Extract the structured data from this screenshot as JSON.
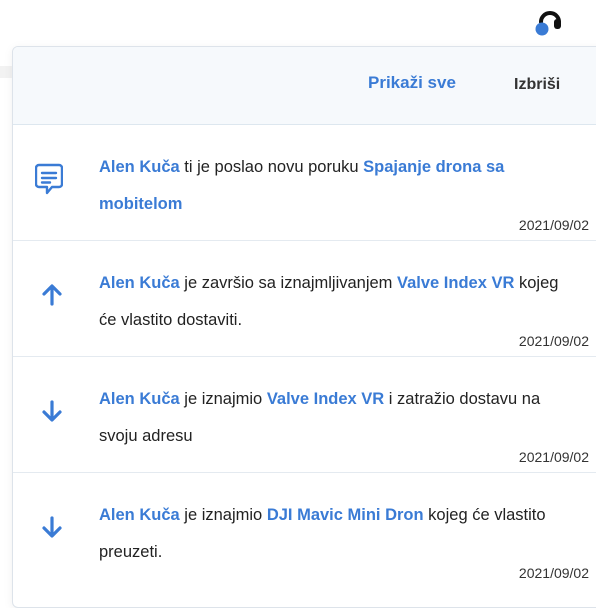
{
  "header": {
    "show_all_label": "Prikaži sve",
    "delete_label": "Izbriši"
  },
  "colors": {
    "accent": "#3a7bd5",
    "text": "#222222",
    "header_bg": "#f6f9fc"
  },
  "notifications": [
    {
      "icon": "message-icon",
      "user": "Alen Kuča",
      "text1": " ti je poslao novu poruku ",
      "link": "Spajanje drona sa mobitelom",
      "text2": "",
      "date": "2021/09/02"
    },
    {
      "icon": "arrow-up-icon",
      "user": "Alen Kuča",
      "text1": " je završio sa iznajmljivanjem ",
      "link": "Valve Index VR",
      "text2": " kojeg će vlastito dostaviti.",
      "date": "2021/09/02"
    },
    {
      "icon": "arrow-down-icon",
      "user": "Alen Kuča",
      "text1": " je iznajmio ",
      "link": "Valve Index VR",
      "text2": " i zatražio dostavu na svoju adresu",
      "date": "2021/09/02"
    },
    {
      "icon": "arrow-down-icon",
      "user": "Alen Kuča",
      "text1": " je iznajmio ",
      "link": "DJI Mavic Mini Dron",
      "text2": " kojeg će vlastito preuzeti.",
      "date": "2021/09/02"
    }
  ]
}
